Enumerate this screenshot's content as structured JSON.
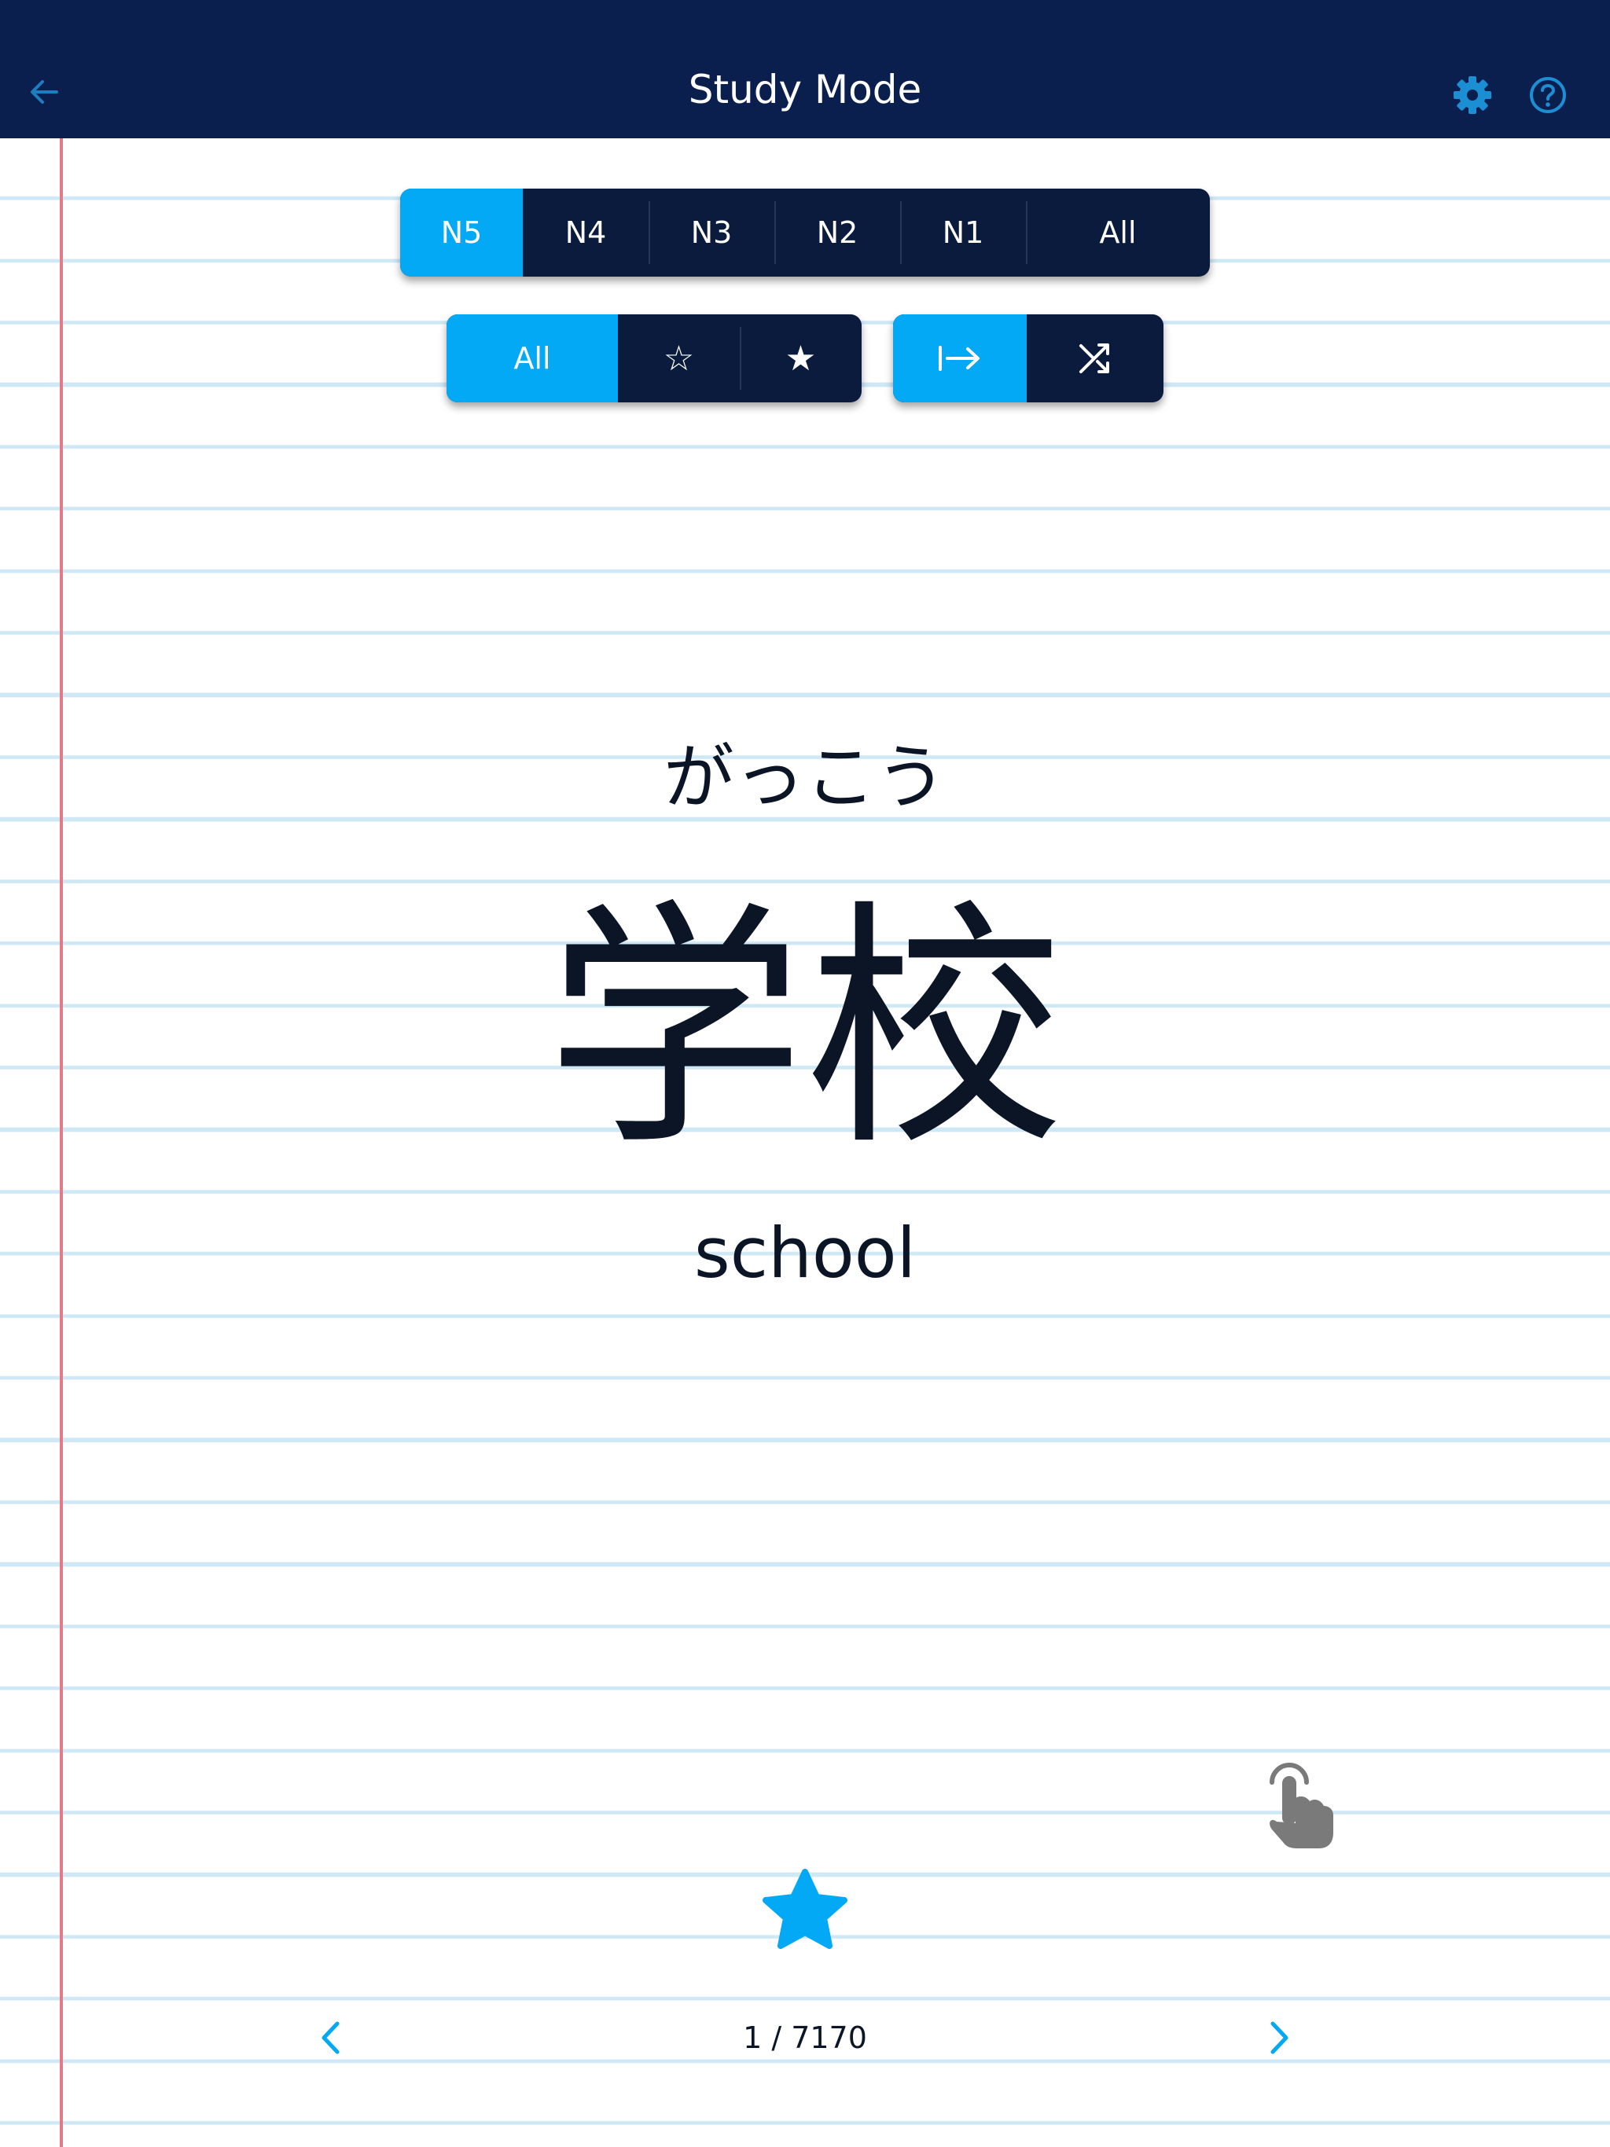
{
  "header": {
    "title": "Study Mode",
    "icons": [
      "back-arrow-icon",
      "gear-icon",
      "help-icon"
    ]
  },
  "level_filter": {
    "items": [
      "N5",
      "N4",
      "N3",
      "N2",
      "N1",
      "All"
    ],
    "selected": "N5"
  },
  "favorite_filter": {
    "all_label": "All",
    "outline_star": "☆",
    "solid_star": "★",
    "selected": "All"
  },
  "order_mode": {
    "icons": [
      "sequential-icon",
      "shuffle-icon"
    ],
    "selected": "sequential"
  },
  "card": {
    "reading": "がっこう",
    "kanji": "学校",
    "meaning": "school"
  },
  "pagination": {
    "counter": "1 / 7170"
  },
  "colors": {
    "header_bg": "#0a1f4d",
    "accent": "#03a9f4",
    "segment_bg": "#0a1b3d",
    "rule_line": "#cfe8f5",
    "margin_line": "#e57a85"
  }
}
